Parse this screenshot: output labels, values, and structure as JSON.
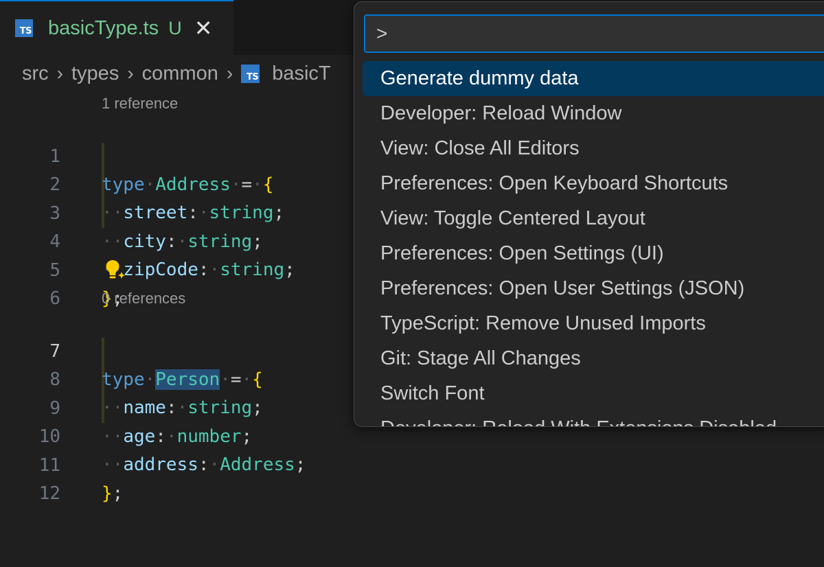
{
  "tab": {
    "icon": "typescript-file-icon",
    "icon_text": "TS",
    "filename": "basicType.ts",
    "status": "U",
    "close": "✕"
  },
  "breadcrumb": {
    "items": [
      "src",
      "types",
      "common"
    ],
    "file_icon_text": "TS",
    "file": "basicT",
    "separator": "›"
  },
  "editor": {
    "lens1": "1 reference",
    "lens2": "0 references",
    "line_numbers": [
      "1",
      "2",
      "3",
      "4",
      "5",
      "6",
      "7",
      "8",
      "9",
      "10",
      "11",
      "12"
    ],
    "active_line": "7",
    "type1": {
      "keyword": "type",
      "name": "Address",
      "eq": "=",
      "open": "{",
      "fields": [
        {
          "name": "street",
          "type": "string"
        },
        {
          "name": "city",
          "type": "string"
        },
        {
          "name": "zipCode",
          "type": "string"
        }
      ],
      "close": "}",
      "semi": ";"
    },
    "type2": {
      "keyword": "type",
      "name": "Person",
      "eq": "=",
      "open": "{",
      "fields": [
        {
          "name": "name",
          "type": "string"
        },
        {
          "name": "age",
          "type": "number"
        },
        {
          "name": "address",
          "type": "Address"
        }
      ],
      "close": "}",
      "semi": ";"
    },
    "colon": ":",
    "semi": ";",
    "dots": "··"
  },
  "palette": {
    "input_value": ">",
    "items": [
      "Generate dummy data",
      "Developer: Reload Window",
      "View: Close All Editors",
      "Preferences: Open Keyboard Shortcuts",
      "View: Toggle Centered Layout",
      "Preferences: Open Settings (UI)",
      "Preferences: Open User Settings (JSON)",
      "TypeScript: Remove Unused Imports",
      "Git: Stage All Changes",
      "Switch Font",
      "Developer: Reload With Extensions Disabled"
    ],
    "selected_index": 0
  },
  "colors": {
    "accent": "#0078d4",
    "selected_item": "#04395e",
    "keyword": "#569cd6",
    "type": "#4ec9b0",
    "property": "#9cdcfe",
    "brace": "#ffd700",
    "untracked": "#73c991"
  }
}
